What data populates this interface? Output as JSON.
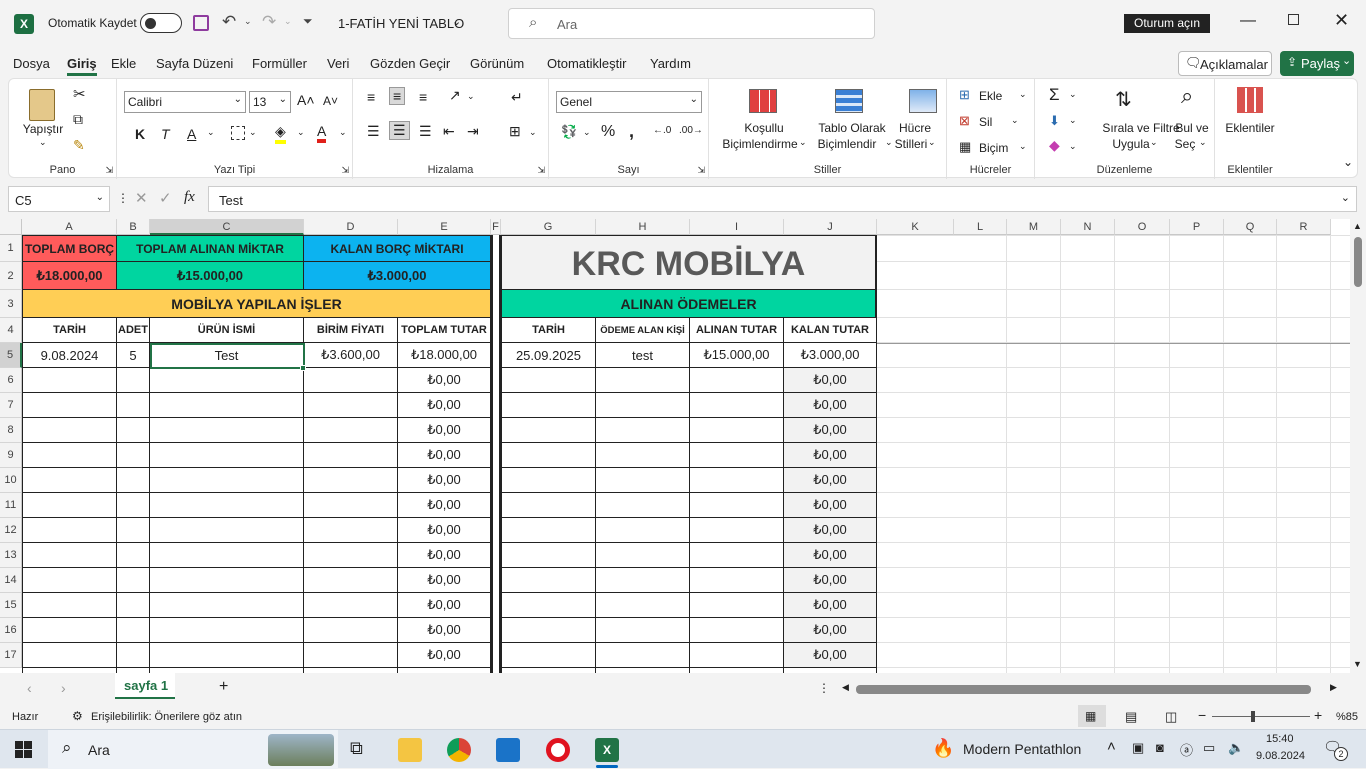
{
  "titlebar": {
    "autosave_label": "Otomatik Kaydet",
    "file_name": "1-FATİH YENİ TABLO",
    "search_placeholder": "Ara",
    "signin": "Oturum açın"
  },
  "menu": {
    "items": [
      "Dosya",
      "Giriş",
      "Ekle",
      "Sayfa Düzeni",
      "Formüller",
      "Veri",
      "Gözden Geçir",
      "Görünüm",
      "Otomatikleştir",
      "Yardım"
    ],
    "comments": "Açıklamalar",
    "share": "Paylaş"
  },
  "ribbon": {
    "paste": "Yapıştır",
    "groups": {
      "clipboard": "Pano",
      "font": "Yazı Tipi",
      "alignment": "Hizalama",
      "number": "Sayı",
      "styles": "Stiller",
      "cells": "Hücreler",
      "editing": "Düzenleme",
      "addins": "Eklentiler"
    },
    "font_name": "Calibri",
    "font_size": "13",
    "number_format": "Genel",
    "bold": "K",
    "italic": "T",
    "underline": "A",
    "cond_format": [
      "Koşullu",
      "Biçimlendirme"
    ],
    "table_format": [
      "Tablo Olarak",
      "Biçimlendir"
    ],
    "cell_styles": [
      "Hücre",
      "Stilleri"
    ],
    "insert": "Ekle",
    "delete": "Sil",
    "format": "Biçim",
    "sort_filter": [
      "Sırala ve Filtre",
      "Uygula"
    ],
    "find_select": [
      "Bul ve",
      "Seç"
    ],
    "addins_btn": "Eklentiler"
  },
  "formula_bar": {
    "name_box": "C5",
    "formula": "Test",
    "fx": "fx"
  },
  "columns": [
    "A",
    "B",
    "C",
    "D",
    "E",
    "F",
    "G",
    "H",
    "I",
    "J",
    "K",
    "L",
    "M",
    "N",
    "O",
    "P",
    "Q",
    "R"
  ],
  "rows": [
    "1",
    "2",
    "3",
    "4",
    "5",
    "6",
    "7",
    "8",
    "9",
    "10",
    "11",
    "12",
    "13",
    "14",
    "15",
    "16",
    "17"
  ],
  "sheet": {
    "total_debt_label": "TOPLAM BORÇ",
    "total_received_label": "TOPLAM ALINAN MİKTAR",
    "remaining_label": "KALAN BORÇ MİKTARI",
    "total_debt": "₺18.000,00",
    "total_received": "₺15.000,00",
    "remaining": "₺3.000,00",
    "company": "KRC MOBİLYA",
    "jobs_title": "MOBİLYA YAPILAN İŞLER",
    "payments_title": "ALINAN ÖDEMELER",
    "jobs_headers": [
      "TARİH",
      "ADET",
      "ÜRÜN İSMİ",
      "BİRİM FİYATI",
      "TOPLAM TUTAR"
    ],
    "payment_headers": [
      "TARİH",
      "ÖDEME ALAN KİŞİ",
      "ALINAN TUTAR",
      "KALAN TUTAR"
    ],
    "job_row": [
      "9.08.2024",
      "5",
      "Test",
      "₺3.600,00",
      "₺18.000,00"
    ],
    "payment_row": [
      "25.09.2025",
      "test",
      "₺15.000,00",
      "₺3.000,00"
    ],
    "zero": "₺0,00"
  },
  "tabs": {
    "sheet_name": "sayfa 1"
  },
  "status": {
    "ready": "Hazır",
    "accessibility": "Erişilebilirlik: Önerilere göz atın",
    "zoom": "%85"
  },
  "taskbar": {
    "search": "Ara",
    "weather": "Modern Pentathlon",
    "time": "15:40",
    "date": "9.08.2024",
    "notif": "2"
  },
  "colors": {
    "red": "#ff5b5b",
    "green": "#00d5a0",
    "blue": "#0cb3f0",
    "yellow": "#ffce55",
    "gray": "#f2f2f2",
    "excel_green": "#217346"
  }
}
